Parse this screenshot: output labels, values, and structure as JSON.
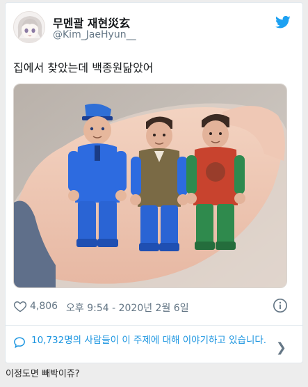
{
  "tweet": {
    "display_name": "무멘괄 재현災玄",
    "handle": "@Kim_JaeHyun__",
    "text": "집에서 찾았는데 백종원닮았어",
    "like_count": "4,806",
    "timestamp": "오후 9:54 - 2020년 2월 6일",
    "conversation_text": "10,732명의 사람들이 이 주제에 대해 이야기하고 있습니다.",
    "icons": {
      "platform": "twitter-bird-icon",
      "like": "heart-icon",
      "info": "info-icon",
      "conversation": "speech-bubble-icon",
      "more": "chevron-right-icon"
    },
    "colors": {
      "accent": "#1da1f2",
      "link": "#1b95e0",
      "muted": "#657786"
    }
  },
  "caption": "이정도면 빼박이쥬?"
}
